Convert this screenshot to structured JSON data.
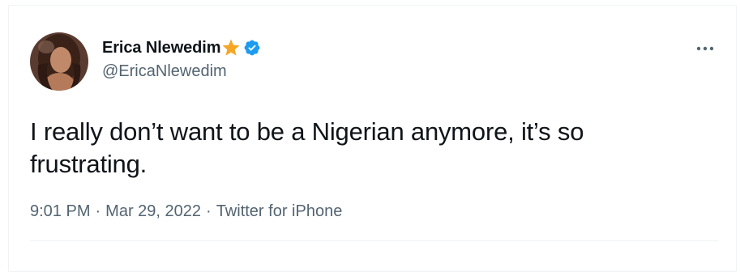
{
  "tweet": {
    "author": {
      "display_name": "Erica Nlewedim",
      "handle": "@EricaNlewedim",
      "badges": [
        "star-icon",
        "verified-icon"
      ],
      "verified_color": "#1d9bf0",
      "star_color": "#f5a623"
    },
    "text": "I really don’t want to be a Nigerian anymore, it’s so frustrating.",
    "time": "9:01 PM",
    "date": "Mar 29, 2022",
    "source": "Twitter for iPhone",
    "separator": "·",
    "more_icon": "more-options-icon"
  }
}
